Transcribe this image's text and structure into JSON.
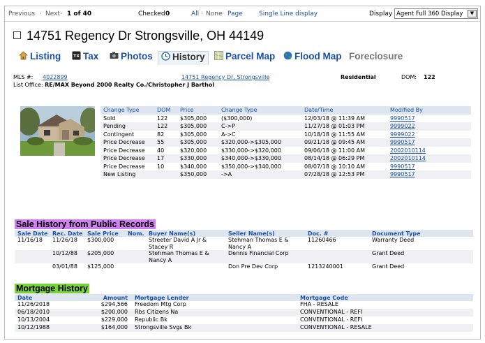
{
  "topbar": {
    "previous": "Previous",
    "dot1": "·",
    "next": "Next",
    "dot2": "·",
    "position": "1 of 40",
    "checked_label": "Checked",
    "checked_count": "0",
    "select_all": "All",
    "dot3": "·",
    "select_none": "None",
    "dot4": "·",
    "select_page": "Page",
    "single_line": "Single Line display",
    "display_label": "Display",
    "display_value": "Agent Full 360 Display"
  },
  "title": "14751 Regency Dr Strongsville, OH 44149",
  "tabs": {
    "listing": "Listing",
    "tax": "Tax",
    "photos": "Photos",
    "history": "History",
    "parcel_map": "Parcel Map",
    "flood_map": "Flood Map",
    "foreclosure": "Foreclosure"
  },
  "listing": {
    "mls_label": "MLS #:",
    "mls_number": "4022899",
    "address_link": "14751 Regency Dr, Strongsville",
    "type": "Residential",
    "dom_label": "DOM:",
    "dom_value": "122",
    "office_label": "List Office:",
    "office_value": "RE/MAX Beyond 2000 Realty Co./Christopher J Barthol"
  },
  "status_history": {
    "headers": [
      "Change Type",
      "DOM",
      "Price",
      "Change Type",
      "Date/Time",
      "Modified By"
    ],
    "rows": [
      [
        "Sold",
        "122",
        "$305,000",
        "($300,000)",
        "12/03/18 @ 11:39 AM",
        "9990517"
      ],
      [
        "Pending",
        "122",
        "$305,000",
        "C->P",
        "11/27/18 @ 01:03 PM",
        "9999022"
      ],
      [
        "Contingent",
        "82",
        "$305,000",
        "A->C",
        "10/18/18 @ 11:55 AM",
        "9999022"
      ],
      [
        "Price Decrease",
        "55",
        "$305,000",
        "$320,000->$305,000",
        "09/21/18 @ 09:45 AM",
        "9990517"
      ],
      [
        "Price Decrease",
        "40",
        "$320,000",
        "$330,000->$320,000",
        "09/06/18 @ 11:00 AM",
        "2002010114"
      ],
      [
        "Price Decrease",
        "17",
        "$330,000",
        "$340,000->$330,000",
        "08/14/18 @ 06:29 PM",
        "2002010114"
      ],
      [
        "Price Decrease",
        "10",
        "$340,000",
        "$350,000->$340,000",
        "08/07/18 @ 10:10 AM",
        "9990517"
      ],
      [
        "New Listing",
        "",
        "$350,000",
        "->A",
        "07/28/18 @ 12:53 PM",
        "9990517"
      ]
    ]
  },
  "sale_history": {
    "title": "Sale History from Public Records",
    "headers": [
      "Sale Date",
      "Rec. Date",
      "Sale Price",
      "Nom.",
      "Buyer Name(s)",
      "Seller Name(s)",
      "Doc. #",
      "Document Type"
    ],
    "rows": [
      [
        "11/16/18",
        "11/26/18",
        "$300,000",
        "",
        "Streeter David A Jr & Stacey R",
        "Stehman Thomas E & Nancy A",
        "11260466",
        "Warranty Deed"
      ],
      [
        "",
        "10/12/88",
        "$205,000",
        "",
        "Stehman Thomas E & Nancy A",
        "Dennis Financial Corp",
        "",
        "Grant Deed"
      ],
      [
        "",
        "03/01/88",
        "$125,000",
        "",
        "",
        "Don Pre Dev Corp",
        "1213240001",
        "Grant Deed"
      ]
    ]
  },
  "mortgage_history": {
    "title": "Mortgage History",
    "headers": [
      "Date",
      "Amount",
      "Mortgage Lender",
      "Mortgage Code"
    ],
    "rows": [
      [
        "11/26/2018",
        "$294,566",
        "Freedom Mtg Corp",
        "FHA - RESALE"
      ],
      [
        "06/18/2010",
        "$200,000",
        "Rbs Citizens Na",
        "CONVENTIONAL - REFI"
      ],
      [
        "10/13/2004",
        "$229,000",
        "Republic Bk",
        "CONVENTIONAL - REFI"
      ],
      [
        "10/12/1988",
        "$164,000",
        "Strongsville Svgs Bk",
        "CONVENTIONAL - RESALE"
      ]
    ]
  },
  "colors": {
    "link": "#1a4fa8",
    "sale_heading_bg": "#d07ff0",
    "mortgage_heading_bg": "#7bd53a",
    "table_header_bg": "#dde6ef"
  },
  "icons": {
    "listing": "house-icon",
    "tax": "tax-icon",
    "photos": "camera-icon",
    "history": "clock-icon",
    "parcel_map": "map-icon",
    "flood_map": "globe-icon",
    "display": "chevron-down-icon"
  }
}
